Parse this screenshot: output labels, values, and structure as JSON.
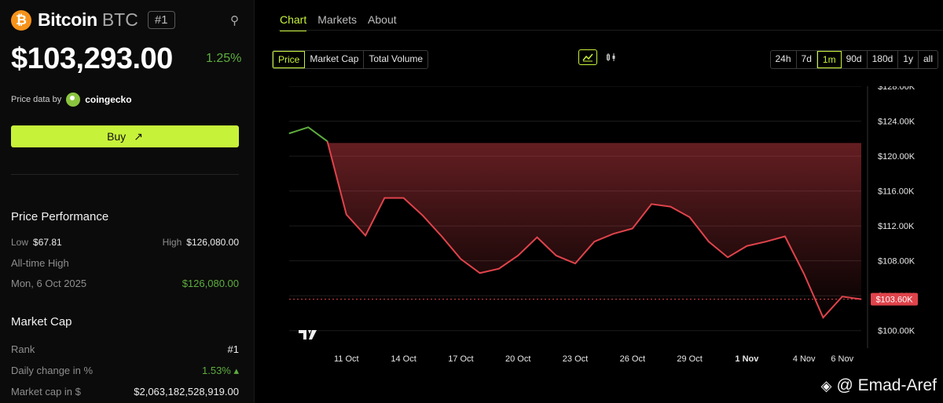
{
  "coin": {
    "logo_glyph": "₿",
    "name": "Bitcoin",
    "symbol": "BTC",
    "rank_badge": "#1",
    "price": "$103,293.00",
    "change": "1.25%",
    "price_data_label": "Price data by",
    "source": "coingecko"
  },
  "buy": {
    "label": "Buy",
    "arrow": "↗"
  },
  "performance": {
    "title": "Price Performance",
    "low_label": "Low",
    "low_value": "$67.81",
    "high_label": "High",
    "high_value": "$126,080.00",
    "ath_label": "All-time High",
    "ath_date": "Mon, 6 Oct 2025",
    "ath_value": "$126,080.00"
  },
  "market_cap": {
    "title": "Market Cap",
    "rank_label": "Rank",
    "rank_value": "#1",
    "daily_label": "Daily change in %",
    "daily_value": "1.53% ▴",
    "cap_label": "Market cap in $",
    "cap_value": "$2,063,182,528,919.00"
  },
  "tabs": [
    "Chart",
    "Markets",
    "About"
  ],
  "metrics": [
    "Price",
    "Market Cap",
    "Total Volume"
  ],
  "ranges": [
    "24h",
    "7d",
    "1m",
    "90d",
    "180d",
    "1y",
    "all"
  ],
  "colors": {
    "accent": "#c7f23a",
    "up": "#5dae3e",
    "down": "#e0434b",
    "btc": "#f7931a"
  },
  "watermark": "@ Emad-Aref",
  "chart_data": {
    "type": "line",
    "x_labels": [
      "11 Oct",
      "14 Oct",
      "17 Oct",
      "20 Oct",
      "23 Oct",
      "26 Oct",
      "29 Oct",
      "1 Nov",
      "4 Nov",
      "6 Nov"
    ],
    "y_ticks": [
      "$100.00K",
      "$104.00K",
      "$108.00K",
      "$112.00K",
      "$116.00K",
      "$120.00K",
      "$124.00K",
      "$128.00K"
    ],
    "ylim": [
      98000,
      128000
    ],
    "current_label": "$103.60K",
    "current_value": 103600,
    "baseline_value": 121500,
    "series": [
      {
        "x": [
          "8 Oct",
          "9 Oct",
          "10 Oct",
          "11 Oct",
          "12 Oct",
          "13 Oct",
          "14 Oct",
          "15 Oct",
          "16 Oct",
          "17 Oct",
          "18 Oct",
          "19 Oct",
          "20 Oct",
          "21 Oct",
          "22 Oct",
          "23 Oct",
          "24 Oct",
          "25 Oct",
          "26 Oct",
          "27 Oct",
          "28 Oct",
          "29 Oct",
          "30 Oct",
          "31 Oct",
          "1 Nov",
          "2 Nov",
          "3 Nov",
          "4 Nov",
          "5 Nov",
          "6 Nov",
          "7 Nov"
        ],
        "values": [
          122600,
          123300,
          121700,
          113300,
          110900,
          115200,
          115200,
          113200,
          110800,
          108200,
          106600,
          107100,
          108600,
          110700,
          108600,
          107700,
          110200,
          111100,
          111700,
          114500,
          114200,
          113000,
          110200,
          108400,
          109700,
          110200,
          110800,
          106500,
          101500,
          103900,
          103600
        ]
      }
    ]
  }
}
